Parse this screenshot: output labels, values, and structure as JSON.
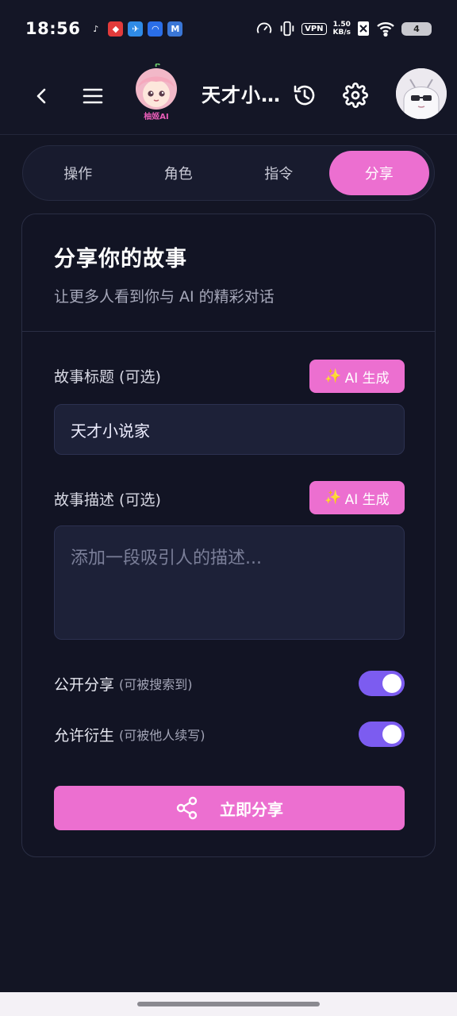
{
  "status_bar": {
    "time": "18:56",
    "vpn": "VPN",
    "net_speed_value": "1.50",
    "net_speed_unit": "KB/s",
    "battery": "4",
    "apps": [
      {
        "icon": "tiktok-icon",
        "glyph": "♪",
        "color": "#141626"
      },
      {
        "icon": "red-app-icon",
        "glyph": "◆",
        "color": "#e23b3b"
      },
      {
        "icon": "blue-app-icon",
        "glyph": "✈",
        "color": "#2f8be6"
      },
      {
        "icon": "nova-app-icon",
        "glyph": "◠",
        "color": "#2a6ee8"
      },
      {
        "icon": "mail-app-icon",
        "glyph": "M",
        "color": "#3a76d6"
      }
    ]
  },
  "header": {
    "bot_name": "柚姬AI",
    "chat_title": "天才小…"
  },
  "tabs": [
    {
      "label": "操作",
      "active": false
    },
    {
      "label": "角色",
      "active": false
    },
    {
      "label": "指令",
      "active": false
    },
    {
      "label": "分享",
      "active": true
    }
  ],
  "card": {
    "title": "分享你的故事",
    "subtitle": "让更多人看到你与 AI 的精彩对话",
    "story_title_label": "故事标题 (可选)",
    "ai_generate_label": "AI 生成",
    "story_title_value": "天才小说家",
    "story_desc_label": "故事描述 (可选)",
    "story_desc_placeholder": "添加一段吸引人的描述...",
    "public_label": "公开分享",
    "public_hint": "(可被搜索到)",
    "public_on": true,
    "derive_label": "允许衍生",
    "derive_hint": "(可被他人续写)",
    "derive_on": true,
    "share_button": "立即分享"
  },
  "colors": {
    "accent_pink": "#ec6fd0",
    "toggle_purple": "#7c5cf0",
    "background": "#131524"
  }
}
